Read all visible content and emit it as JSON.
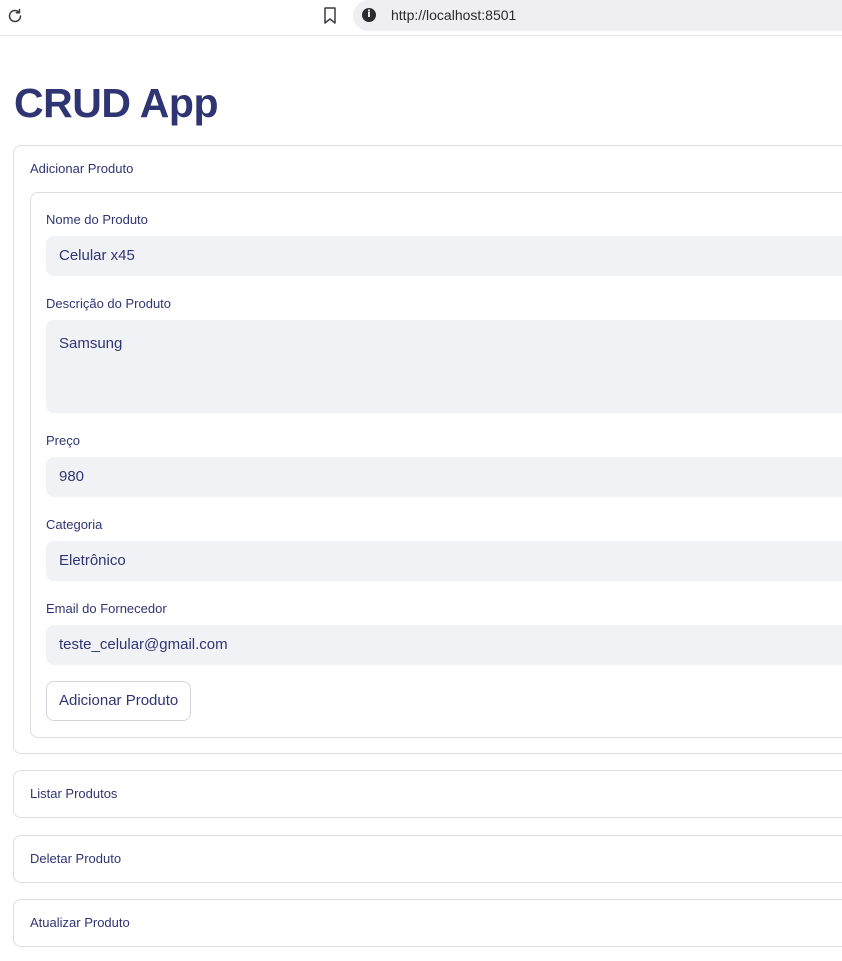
{
  "browser": {
    "url": "http://localhost:8501"
  },
  "page": {
    "title": "CRUD App"
  },
  "sections": {
    "add": {
      "label": "Adicionar Produto",
      "fields": {
        "name": {
          "label": "Nome do Produto",
          "value": "Celular x45"
        },
        "description": {
          "label": "Descrição do Produto",
          "value": "Samsung"
        },
        "price": {
          "label": "Preço",
          "value": "980"
        },
        "category": {
          "label": "Categoria",
          "value": "Eletrônico"
        },
        "email": {
          "label": "Email do Fornecedor",
          "value": "teste_celular@gmail.com"
        }
      },
      "submit_label": "Adicionar Produto"
    },
    "list": {
      "label": "Listar Produtos"
    },
    "delete": {
      "label": "Deletar Produto"
    },
    "update": {
      "label": "Atualizar Produto"
    }
  },
  "colors": {
    "title": "#2f3573",
    "input_bg": "#f1f2f6",
    "border": "#dcdde3"
  },
  "icons": [
    "reload-icon",
    "bookmark-icon",
    "info-icon"
  ]
}
